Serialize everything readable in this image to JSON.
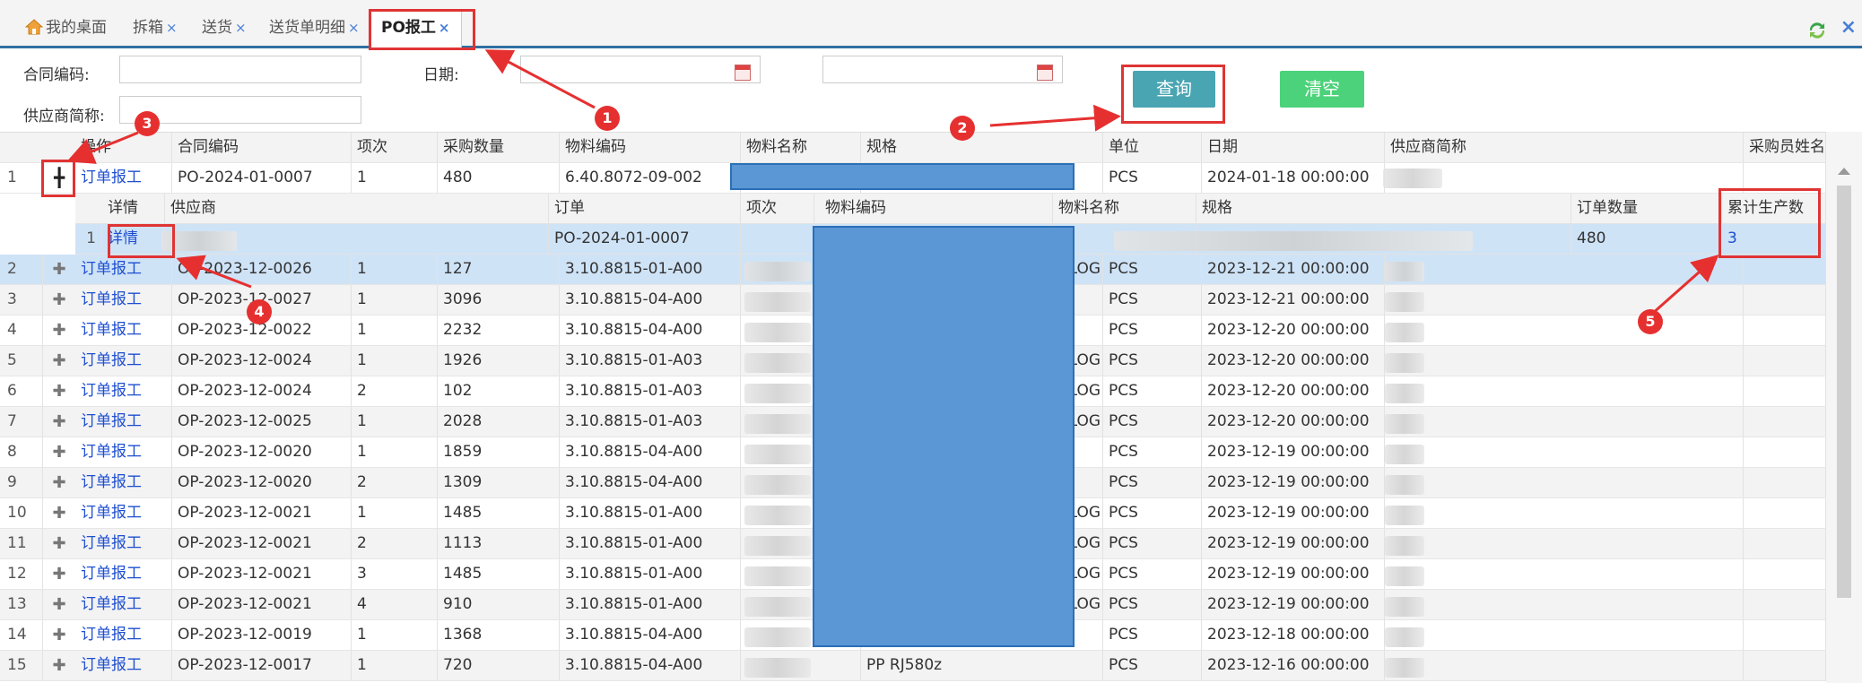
{
  "tabs": [
    {
      "label": "我的桌面",
      "closable": false
    },
    {
      "label": "拆箱",
      "closable": true
    },
    {
      "label": "送货",
      "closable": true
    },
    {
      "label": "送货单明细",
      "closable": true
    },
    {
      "label": "PO报工",
      "closable": true,
      "active": true
    }
  ],
  "tab_close_glyph": "×",
  "window_close_glyph": "×",
  "form": {
    "contract_label": "合同编码:",
    "date_label": "日期:",
    "supplier_label": "供应商简称:",
    "contract_value": "",
    "date_from": "",
    "date_to": "",
    "supplier_value": "",
    "query_button": "查询",
    "clear_button": "清空"
  },
  "grid": {
    "columns": [
      "操作",
      "合同编码",
      "项次",
      "采购数量",
      "物料编码",
      "物料名称",
      "规格",
      "单位",
      "日期",
      "供应商简称",
      "采购员姓名"
    ],
    "rows": [
      {
        "n": "1",
        "op": "订单报工",
        "contract": "PO-2024-01-0007",
        "item": "1",
        "qty": "480",
        "code": "6.40.8072-09-002",
        "spec_tail": "",
        "unit": "PCS",
        "date": "2024-01-18 00:00:00",
        "expanded": true
      },
      {
        "n": "2",
        "op": "订单报工",
        "contract": "OP-2023-12-0026",
        "item": "1",
        "qty": "127",
        "code": "3.10.8815-01-A00",
        "spec_tail": "LOG",
        "unit": "PCS",
        "date": "2023-12-21 00:00:00"
      },
      {
        "n": "3",
        "op": "订单报工",
        "contract": "OP-2023-12-0027",
        "item": "1",
        "qty": "3096",
        "code": "3.10.8815-04-A00",
        "spec_tail": "",
        "unit": "PCS",
        "date": "2023-12-21 00:00:00"
      },
      {
        "n": "4",
        "op": "订单报工",
        "contract": "OP-2023-12-0022",
        "item": "1",
        "qty": "2232",
        "code": "3.10.8815-04-A00",
        "spec_tail": "",
        "unit": "PCS",
        "date": "2023-12-20 00:00:00"
      },
      {
        "n": "5",
        "op": "订单报工",
        "contract": "OP-2023-12-0024",
        "item": "1",
        "qty": "1926",
        "code": "3.10.8815-01-A03",
        "spec_tail": "LOG",
        "unit": "PCS",
        "date": "2023-12-20 00:00:00"
      },
      {
        "n": "6",
        "op": "订单报工",
        "contract": "OP-2023-12-0024",
        "item": "2",
        "qty": "102",
        "code": "3.10.8815-01-A03",
        "spec_tail": "LOG",
        "unit": "PCS",
        "date": "2023-12-20 00:00:00"
      },
      {
        "n": "7",
        "op": "订单报工",
        "contract": "OP-2023-12-0025",
        "item": "1",
        "qty": "2028",
        "code": "3.10.8815-01-A03",
        "spec_tail": "LOG",
        "unit": "PCS",
        "date": "2023-12-20 00:00:00"
      },
      {
        "n": "8",
        "op": "订单报工",
        "contract": "OP-2023-12-0020",
        "item": "1",
        "qty": "1859",
        "code": "3.10.8815-04-A00",
        "spec_tail": "",
        "unit": "PCS",
        "date": "2023-12-19 00:00:00"
      },
      {
        "n": "9",
        "op": "订单报工",
        "contract": "OP-2023-12-0020",
        "item": "2",
        "qty": "1309",
        "code": "3.10.8815-04-A00",
        "spec_tail": "",
        "unit": "PCS",
        "date": "2023-12-19 00:00:00"
      },
      {
        "n": "10",
        "op": "订单报工",
        "contract": "OP-2023-12-0021",
        "item": "1",
        "qty": "1485",
        "code": "3.10.8815-01-A00",
        "spec_tail": "LOG",
        "unit": "PCS",
        "date": "2023-12-19 00:00:00"
      },
      {
        "n": "11",
        "op": "订单报工",
        "contract": "OP-2023-12-0021",
        "item": "2",
        "qty": "1113",
        "code": "3.10.8815-01-A00",
        "spec_tail": "LOG",
        "unit": "PCS",
        "date": "2023-12-19 00:00:00"
      },
      {
        "n": "12",
        "op": "订单报工",
        "contract": "OP-2023-12-0021",
        "item": "3",
        "qty": "1485",
        "code": "3.10.8815-01-A00",
        "spec_tail": "LOG",
        "unit": "PCS",
        "date": "2023-12-19 00:00:00"
      },
      {
        "n": "13",
        "op": "订单报工",
        "contract": "OP-2023-12-0021",
        "item": "4",
        "qty": "910",
        "code": "3.10.8815-01-A00",
        "spec_tail": "LOG",
        "unit": "PCS",
        "date": "2023-12-19 00:00:00"
      },
      {
        "n": "14",
        "op": "订单报工",
        "contract": "OP-2023-12-0019",
        "item": "1",
        "qty": "1368",
        "code": "3.10.8815-04-A00",
        "spec_tail": "",
        "unit": "PCS",
        "date": "2023-12-18 00:00:00"
      },
      {
        "n": "15",
        "op": "订单报工",
        "contract": "OP-2023-12-0017",
        "item": "1",
        "qty": "720",
        "code": "3.10.8815-04-A00",
        "spec_tail": "PP RJ580z",
        "unit": "PCS",
        "date": "2023-12-16 00:00:00"
      }
    ]
  },
  "subgrid": {
    "columns": [
      "详情",
      "供应商",
      "订单",
      "项次",
      "物料编码",
      "物料名称",
      "规格",
      "订单数量",
      "累计生产数"
    ],
    "rows": [
      {
        "n": "1",
        "detail": "详情",
        "order": "PO-2024-01-0007",
        "order_qty": "480",
        "produced": "3"
      }
    ]
  },
  "annotations": [
    "1",
    "2",
    "3",
    "4",
    "5"
  ],
  "colors": {
    "accent_blue": "#2e6fa3",
    "link": "#1e4fd1",
    "query_button": "#4aa5b3",
    "clear_button": "#4bd27a",
    "highlight_red": "#e03434",
    "redaction": "#5a97d4"
  }
}
